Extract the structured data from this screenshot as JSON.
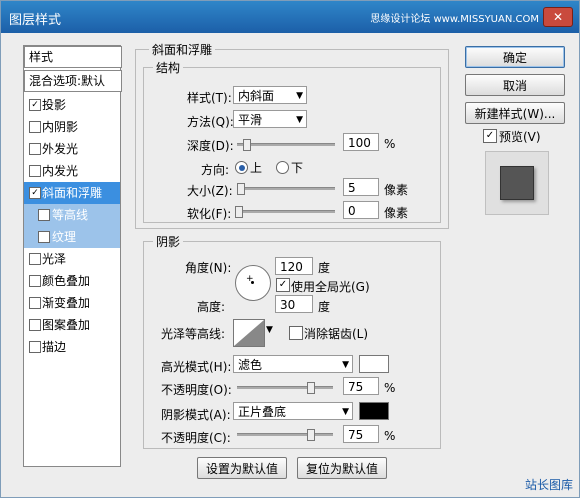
{
  "window": {
    "title": "图层样式",
    "watermark": "思缘设计论坛 www.MISSYUAN.COM",
    "close_icon": "close-icon"
  },
  "left_panel": {
    "header": "样式",
    "blend_default": "混合选项:默认",
    "items": [
      {
        "label": "投影",
        "checked": true
      },
      {
        "label": "内阴影",
        "checked": false
      },
      {
        "label": "外发光",
        "checked": false
      },
      {
        "label": "内发光",
        "checked": false
      },
      {
        "label": "斜面和浮雕",
        "checked": true,
        "selected": true
      },
      {
        "label": "等高线",
        "checked": false,
        "sub": true
      },
      {
        "label": "纹理",
        "checked": false,
        "sub": true
      },
      {
        "label": "光泽",
        "checked": false
      },
      {
        "label": "颜色叠加",
        "checked": false
      },
      {
        "label": "渐变叠加",
        "checked": false
      },
      {
        "label": "图案叠加",
        "checked": false
      },
      {
        "label": "描边",
        "checked": false
      }
    ]
  },
  "bevel": {
    "group_title": "斜面和浮雕",
    "structure_title": "结构",
    "style_label": "样式(T):",
    "style_value": "内斜面",
    "method_label": "方法(Q):",
    "method_value": "平滑",
    "depth_label": "深度(D):",
    "depth_value": "100",
    "depth_unit": "%",
    "direction_label": "方向:",
    "dir_up": "上",
    "dir_down": "下",
    "size_label": "大小(Z):",
    "size_value": "5",
    "size_unit": "像素",
    "soften_label": "软化(F):",
    "soften_value": "0",
    "soften_unit": "像素"
  },
  "shading": {
    "title": "阴影",
    "angle_label": "角度(N):",
    "angle_value": "120",
    "angle_unit": "度",
    "global_light_label": "使用全局光(G)",
    "altitude_label": "高度:",
    "altitude_value": "30",
    "altitude_unit": "度",
    "gloss_label": "光泽等高线:",
    "antialias_label": "消除锯齿(L)",
    "highlight_label": "高光模式(H):",
    "highlight_value": "滤色",
    "highlight_color": "#ffffff",
    "opacity1_label": "不透明度(O):",
    "opacity1_value": "75",
    "opacity1_unit": "%",
    "shadow_label": "阴影模式(A):",
    "shadow_value": "正片叠底",
    "shadow_color": "#000000",
    "opacity2_label": "不透明度(C):",
    "opacity2_value": "75",
    "opacity2_unit": "%"
  },
  "buttons": {
    "ok": "确定",
    "cancel": "取消",
    "new_style": "新建样式(W)...",
    "preview": "预览(V)",
    "set_default": "设置为默认值",
    "reset_default": "复位为默认值"
  },
  "footer_logo": "站长图库"
}
